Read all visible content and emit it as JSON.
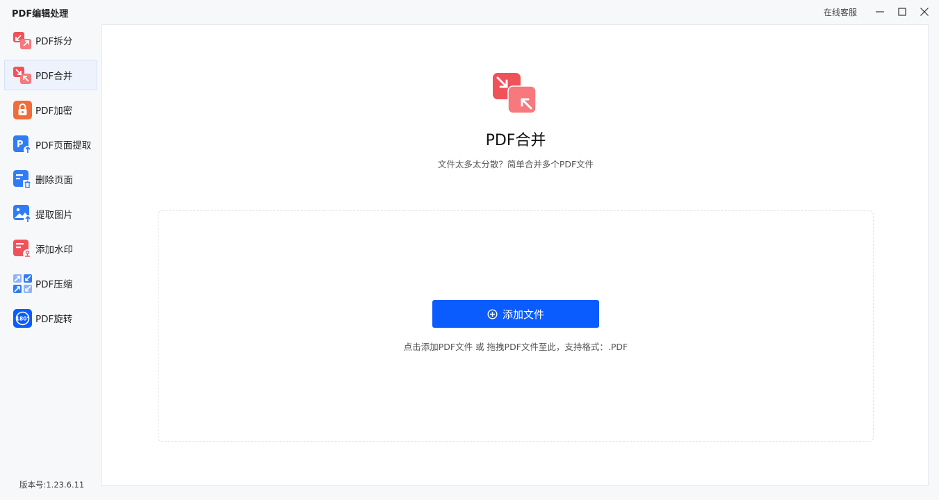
{
  "app": {
    "title": "PDF编辑处理",
    "support_label": "在线客服"
  },
  "sidebar": {
    "items": [
      {
        "label": "PDF拆分",
        "icon": "split-arrows-icon"
      },
      {
        "label": "PDF合并",
        "icon": "merge-arrows-icon"
      },
      {
        "label": "PDF加密",
        "icon": "lock-icon"
      },
      {
        "label": "PDF页面提取",
        "icon": "page-extract-icon"
      },
      {
        "label": "删除页面",
        "icon": "delete-page-icon"
      },
      {
        "label": "提取图片",
        "icon": "extract-image-icon"
      },
      {
        "label": "添加水印",
        "icon": "watermark-icon"
      },
      {
        "label": "PDF压缩",
        "icon": "compress-icon"
      },
      {
        "label": "PDF旋转",
        "icon": "rotate-180-icon"
      }
    ],
    "active_index": 1,
    "version": "版本号:1.23.6.11"
  },
  "main": {
    "title": "PDF合并",
    "subtitle": "文件太多太分散？简单合并多个PDF文件",
    "add_button_label": "添加文件",
    "drop_hint": "点击添加PDF文件 或 拖拽PDF文件至此，支持格式：.PDF"
  },
  "colors": {
    "accent": "#0a5cff",
    "active_bg": "#edf2fc",
    "red_icon": "#f0525a",
    "orange_icon": "#f26b3a",
    "blue_icon": "#2f7cf6"
  },
  "icon_text": {
    "rotate": "180°"
  }
}
